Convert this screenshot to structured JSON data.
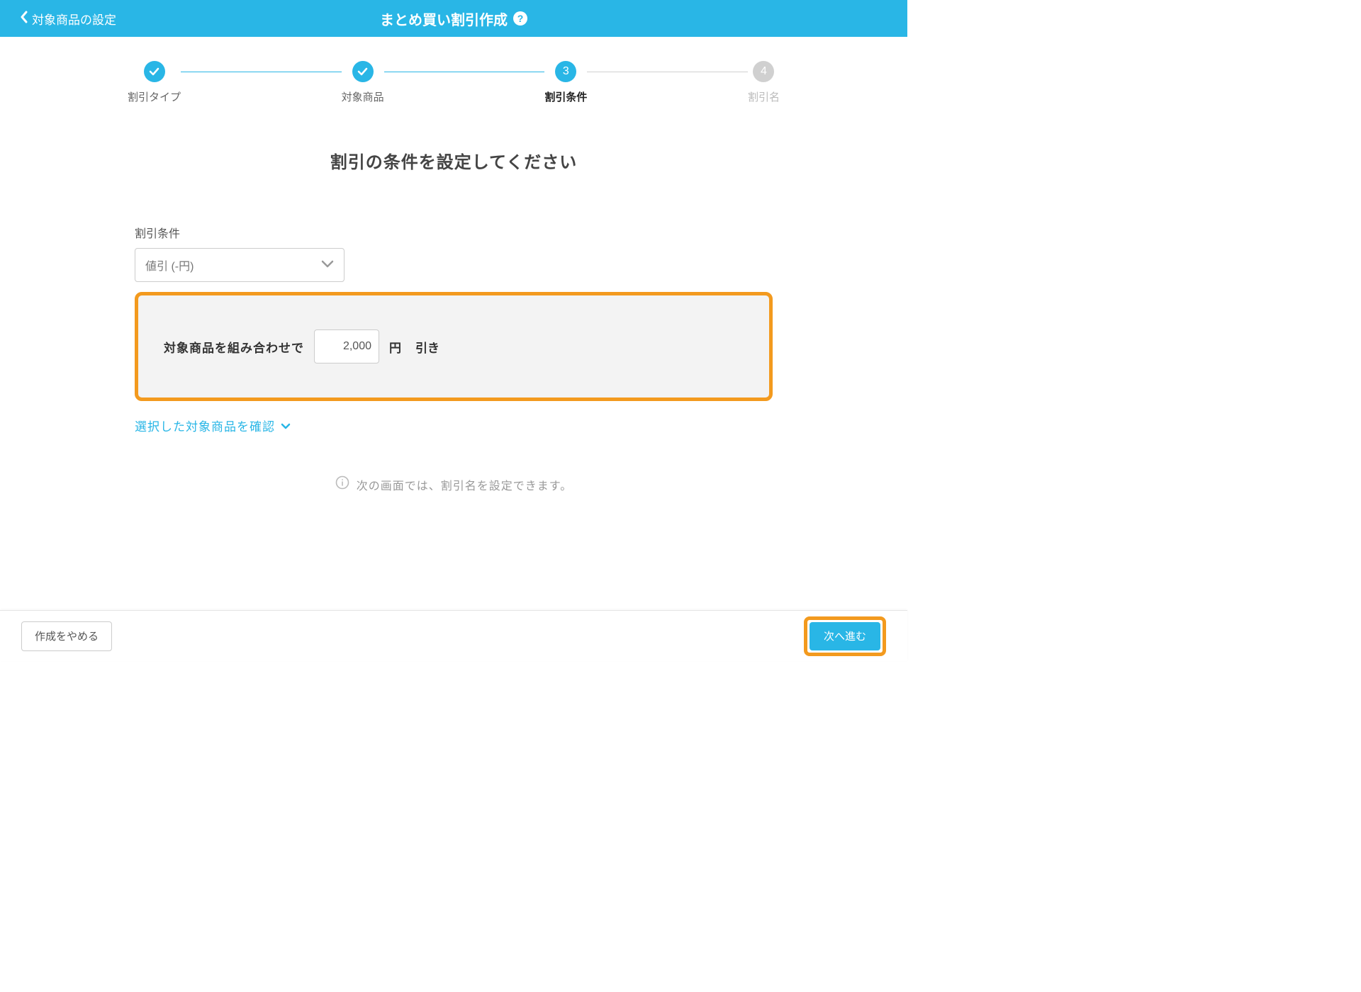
{
  "header": {
    "back_label": "対象商品の設定",
    "title": "まとめ買い割引作成",
    "help_glyph": "?"
  },
  "stepper": {
    "steps": [
      {
        "label": "割引タイプ",
        "state": "done"
      },
      {
        "label": "対象商品",
        "state": "done"
      },
      {
        "label": "割引条件",
        "state": "active",
        "number": "3"
      },
      {
        "label": "割引名",
        "state": "pending",
        "number": "4"
      }
    ]
  },
  "page": {
    "heading": "割引の条件を設定してください",
    "condition_label": "割引条件",
    "select_value": "値引 (-円)",
    "combo": {
      "prefix": "対象商品を組み合わせで",
      "amount": "2,000",
      "unit": "円",
      "suffix": "引き"
    },
    "confirm_link": "選択した対象商品を確認",
    "info_text": "次の画面では、割引名を設定できます。"
  },
  "footer": {
    "cancel": "作成をやめる",
    "next": "次へ進む"
  }
}
